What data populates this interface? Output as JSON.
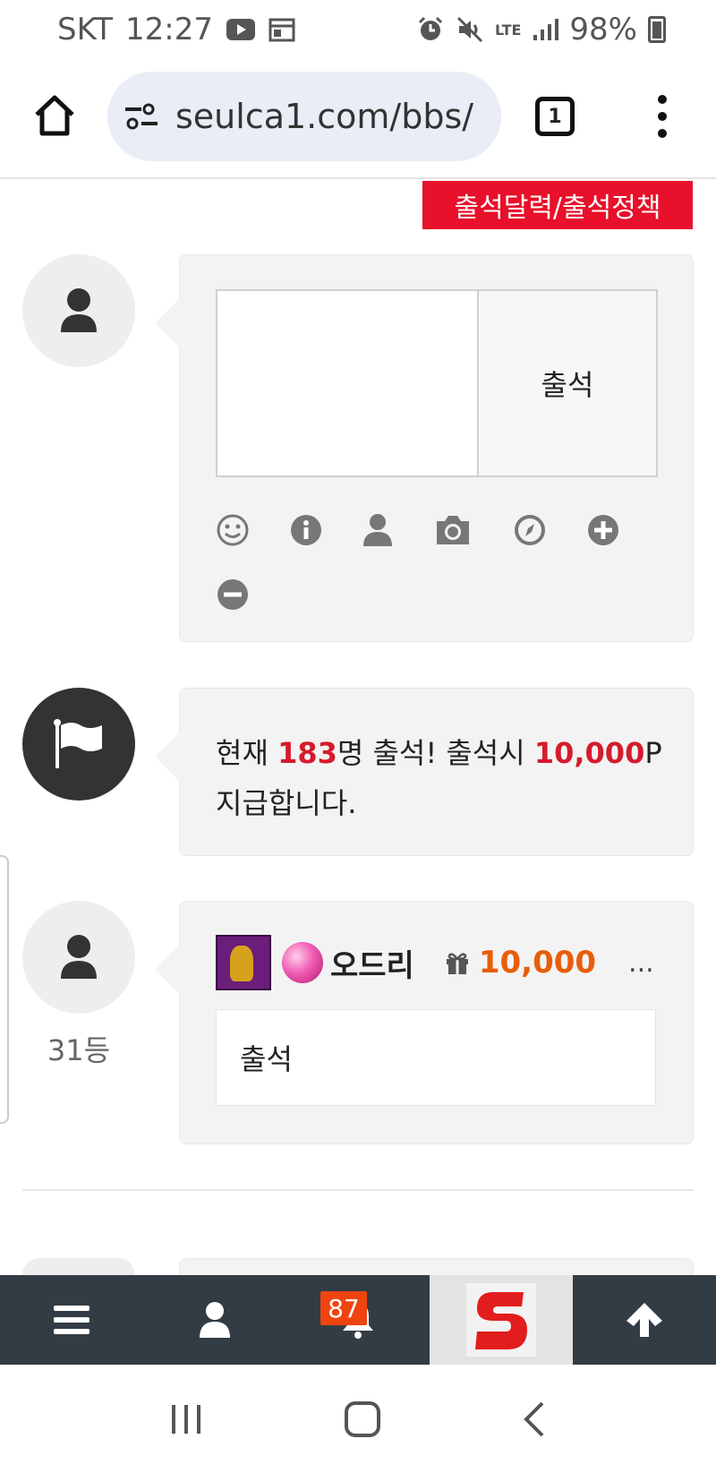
{
  "status_bar": {
    "carrier": "SKT",
    "time": "12:27",
    "network": "LTE",
    "battery": "98%"
  },
  "browser": {
    "url": "seulca1.com/bbs/",
    "tab_count": "1"
  },
  "attendance_link": "출석달력/출석정책",
  "comment_form": {
    "textarea_value": "",
    "submit_label": "출석",
    "tools": [
      "smile-icon",
      "info-icon",
      "user-icon",
      "camera-icon",
      "compass-icon",
      "plus-icon",
      "minus-icon"
    ]
  },
  "notice": {
    "prefix": "현재 ",
    "count": "183",
    "mid": "명 출석! 출석시 ",
    "points": "10,000",
    "suffix_p": "P",
    "line2": "지급합니다."
  },
  "entry": {
    "rank": "31등",
    "nickname": "오드리",
    "points": "10,000",
    "more": "...",
    "message": "출석"
  },
  "bottom_nav": {
    "notification_count": "87"
  },
  "colors": {
    "accent_red": "#e8102a",
    "points_orange": "#e85d0a",
    "nav_bg": "#333c45"
  }
}
